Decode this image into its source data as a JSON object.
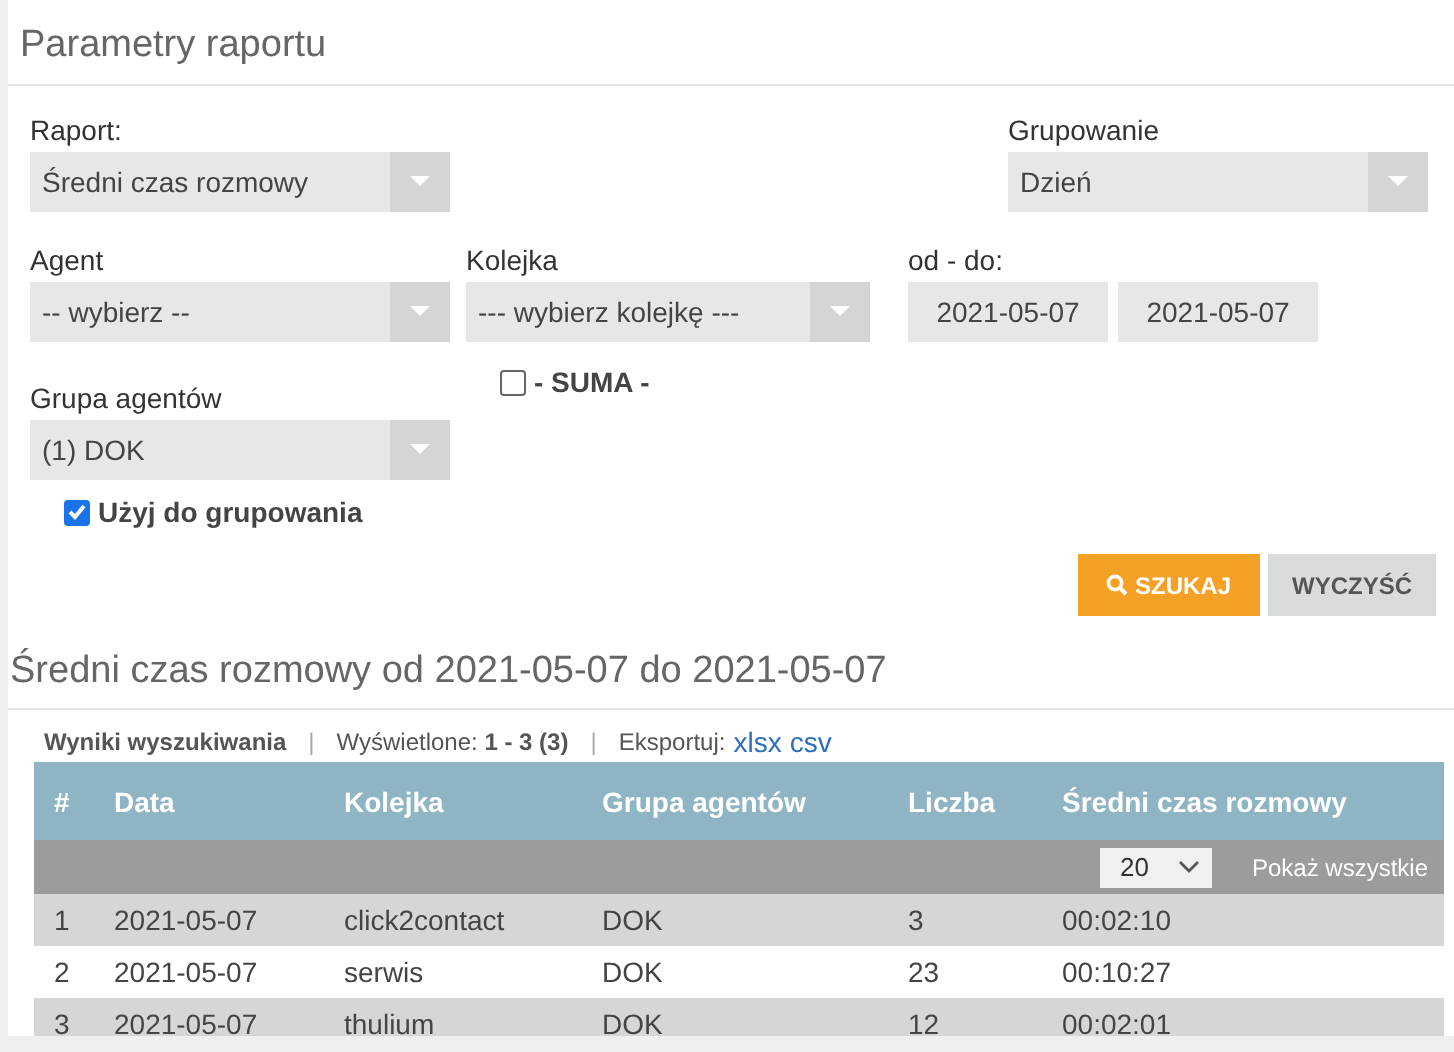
{
  "title": "Parametry raportu",
  "report": {
    "label": "Raport:",
    "value": "Średni czas rozmowy"
  },
  "grouping": {
    "label": "Grupowanie",
    "value": "Dzień"
  },
  "agent": {
    "label": "Agent",
    "value": "-- wybierz --"
  },
  "queue": {
    "label": "Kolejka",
    "value": "--- wybierz kolejkę ---"
  },
  "date_range": {
    "label": "od - do:",
    "from": "2021-05-07",
    "to": "2021-05-07"
  },
  "sum": {
    "label": "- SUMA -",
    "checked": false
  },
  "agent_group": {
    "label": "Grupa agentów",
    "value": "(1) DOK"
  },
  "use_for_grouping": {
    "label": "Użyj do grupowania",
    "checked": true
  },
  "buttons": [
    {
      "kind": "primary",
      "label": "SZUKAJ"
    },
    {
      "kind": "secondary",
      "label": "WYCZYŚĆ"
    }
  ],
  "results_title": "Średni czas rozmowy od 2021-05-07 do 2021-05-07",
  "results_bar": {
    "title": "Wyniki wyszukiwania",
    "separators": [
      "|",
      "|"
    ],
    "shown": "Wyświetlone: **1 - 3 (3)**",
    "export_label": "Eksportuj:",
    "export_links": [
      "xlsx",
      "csv"
    ]
  },
  "table": {
    "columns": [
      "#",
      "Data",
      "Kolejka",
      "Grupa agentów",
      "Liczba",
      "Średni czas rozmowy"
    ],
    "page_size": "20",
    "show_all": "Pokaż wszystkie",
    "rows": [
      [
        "1",
        "2021-05-07",
        "click2contact",
        "DOK",
        "3",
        "00:02:10"
      ],
      [
        "2",
        "2021-05-07",
        "serwis",
        "DOK",
        "23",
        "00:10:27"
      ],
      [
        "3",
        "2021-05-07",
        "thulium",
        "DOK",
        "12",
        "00:02:01"
      ]
    ]
  }
}
